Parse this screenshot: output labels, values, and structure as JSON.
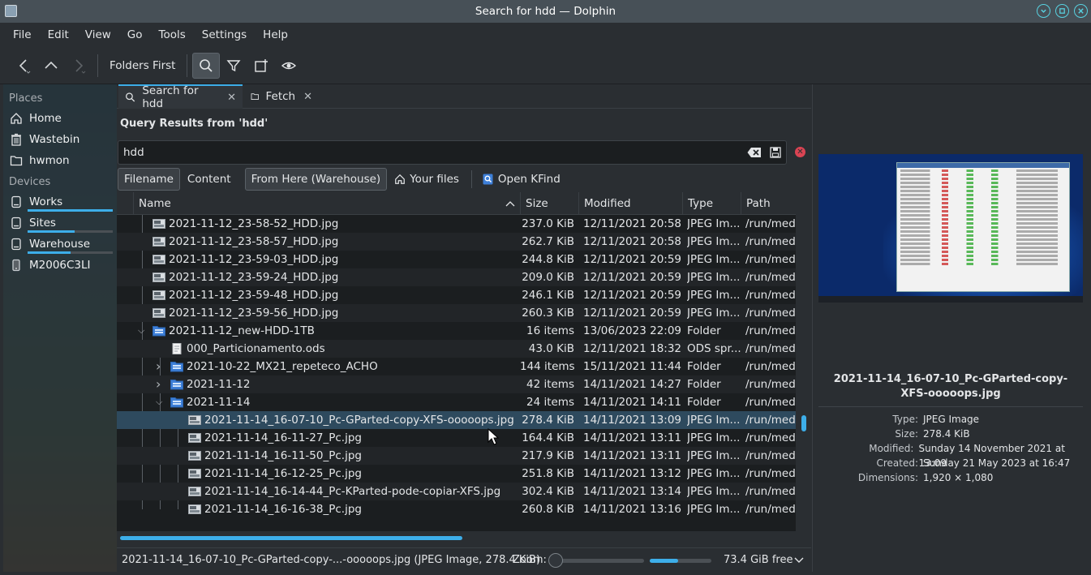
{
  "window": {
    "title": "Search for hdd — Dolphin"
  },
  "menubar": [
    "File",
    "Edit",
    "View",
    "Go",
    "Tools",
    "Settings",
    "Help"
  ],
  "toolbar": {
    "sort_label": "Folders First"
  },
  "places": {
    "places_header": "Places",
    "places_items": [
      {
        "label": "Home",
        "icon": "home-icon"
      },
      {
        "label": "Wastebin",
        "icon": "trash-icon"
      },
      {
        "label": "hwmon",
        "icon": "folder-icon"
      }
    ],
    "devices_header": "Devices",
    "devices": [
      {
        "label": "Works",
        "icon": "drive-icon",
        "usage": 1.0
      },
      {
        "label": "Sites",
        "icon": "drive-icon",
        "usage": 0.55
      },
      {
        "label": "Warehouse",
        "icon": "drive-icon",
        "usage": 0.5
      },
      {
        "label": "M2006C3LI",
        "icon": "phone-icon"
      }
    ]
  },
  "tabs": [
    {
      "label": "Search for hdd",
      "icon": "search-icon",
      "active": true
    },
    {
      "label": "Fetch",
      "icon": "folder-icon",
      "active": false
    }
  ],
  "query": {
    "title": "Query Results from 'hdd'",
    "value": "hdd"
  },
  "filters": [
    {
      "label": "Filename",
      "checked": true
    },
    {
      "label": "Content",
      "checked": false
    },
    {
      "label": "From Here (Warehouse)",
      "checked": true
    },
    {
      "label": "Your files",
      "checked": false,
      "icon": "home-icon"
    },
    {
      "label": "Open KFind",
      "checked": false,
      "icon": "kfind-icon"
    }
  ],
  "columns": {
    "name": "Name",
    "size": "Size",
    "modified": "Modified",
    "type": "Type",
    "path": "Path"
  },
  "rows": [
    {
      "name": "2021-11-12_23-58-52_HDD.jpg",
      "size": "237.0 KiB",
      "modified": "12/11/2021 20:58",
      "type": "JPEG Im...",
      "path": "/run/medi",
      "depth": 1,
      "kind": "image"
    },
    {
      "name": "2021-11-12_23-58-57_HDD.jpg",
      "size": "262.7 KiB",
      "modified": "12/11/2021 20:58",
      "type": "JPEG Im...",
      "path": "/run/medi",
      "depth": 1,
      "kind": "image"
    },
    {
      "name": "2021-11-12_23-59-03_HDD.jpg",
      "size": "244.8 KiB",
      "modified": "12/11/2021 20:59",
      "type": "JPEG Im...",
      "path": "/run/medi",
      "depth": 1,
      "kind": "image"
    },
    {
      "name": "2021-11-12_23-59-24_HDD.jpg",
      "size": "209.0 KiB",
      "modified": "12/11/2021 20:59",
      "type": "JPEG Im...",
      "path": "/run/medi",
      "depth": 1,
      "kind": "image"
    },
    {
      "name": "2021-11-12_23-59-48_HDD.jpg",
      "size": "246.1 KiB",
      "modified": "12/11/2021 20:59",
      "type": "JPEG Im...",
      "path": "/run/medi",
      "depth": 1,
      "kind": "image"
    },
    {
      "name": "2021-11-12_23-59-56_HDD.jpg",
      "size": "260.3 KiB",
      "modified": "12/11/2021 20:59",
      "type": "JPEG Im...",
      "path": "/run/medi",
      "depth": 1,
      "kind": "image"
    },
    {
      "name": "2021-11-12_new-HDD-1TB",
      "size": "16 items",
      "modified": "13/06/2023 22:09",
      "type": "Folder",
      "path": "/run/medi",
      "depth": 1,
      "kind": "folder",
      "expanded": true
    },
    {
      "name": "000_Particionamento.ods",
      "size": "43.0 KiB",
      "modified": "12/11/2021 18:32",
      "type": "ODS spr...",
      "path": "/run/medi",
      "depth": 2,
      "kind": "doc"
    },
    {
      "name": "2021-10-22_MX21_repeteco_ACHO",
      "size": "144 items",
      "modified": "15/11/2021 11:44",
      "type": "Folder",
      "path": "/run/medi",
      "depth": 2,
      "kind": "folder",
      "expanded": false
    },
    {
      "name": "2021-11-12",
      "size": "42 items",
      "modified": "14/11/2021 14:27",
      "type": "Folder",
      "path": "/run/medi",
      "depth": 2,
      "kind": "folder",
      "expanded": false
    },
    {
      "name": "2021-11-14",
      "size": "24 items",
      "modified": "14/11/2021 14:11",
      "type": "Folder",
      "path": "/run/medi",
      "depth": 2,
      "kind": "folder",
      "expanded": true
    },
    {
      "name": "2021-11-14_16-07-10_Pc-GParted-copy-XFS-ooooops.jpg",
      "size": "278.4 KiB",
      "modified": "14/11/2021 13:09",
      "type": "JPEG Im...",
      "path": "/run/medi",
      "depth": 3,
      "kind": "image",
      "selected": true
    },
    {
      "name": "2021-11-14_16-11-27_Pc.jpg",
      "size": "164.4 KiB",
      "modified": "14/11/2021 13:11",
      "type": "JPEG Im...",
      "path": "/run/medi",
      "depth": 3,
      "kind": "image"
    },
    {
      "name": "2021-11-14_16-11-50_Pc.jpg",
      "size": "217.9 KiB",
      "modified": "14/11/2021 13:11",
      "type": "JPEG Im...",
      "path": "/run/medi",
      "depth": 3,
      "kind": "image"
    },
    {
      "name": "2021-11-14_16-12-25_Pc.jpg",
      "size": "251.8 KiB",
      "modified": "14/11/2021 13:12",
      "type": "JPEG Im...",
      "path": "/run/medi",
      "depth": 3,
      "kind": "image"
    },
    {
      "name": "2021-11-14_16-14-44_Pc-KParted-pode-copiar-XFS.jpg",
      "size": "302.4 KiB",
      "modified": "14/11/2021 13:14",
      "type": "JPEG Im...",
      "path": "/run/medi",
      "depth": 3,
      "kind": "image"
    },
    {
      "name": "2021-11-14_16-16-38_Pc.jpg",
      "size": "260.8 KiB",
      "modified": "14/11/2021 13:16",
      "type": "JPEG Im...",
      "path": "/run/medi",
      "depth": 3,
      "kind": "image"
    }
  ],
  "statusbar": {
    "selection": "2021-11-14_16-07-10_Pc-GParted-copy-...-ooooops.jpg (JPEG Image, 278.4 KiB)",
    "zoom_label": "Zoom:",
    "free_space": "73.4 GiB free",
    "disk_usage": 0.46
  },
  "info": {
    "title": "2021-11-14_16-07-10_Pc-GParted-copy-XFS-ooooops.jpg",
    "meta": [
      {
        "key": "Type:",
        "value": "JPEG Image"
      },
      {
        "key": "Size:",
        "value": "278.4 KiB"
      },
      {
        "key": "Modified:",
        "value": "Sunday 14 November 2021 at 13:09"
      },
      {
        "key": "Created:",
        "value": "Sunday 21 May 2023 at 16:47"
      },
      {
        "key": "Dimensions:",
        "value": "1,920 × 1,080"
      }
    ]
  },
  "colors": {
    "accent": "#3daee9",
    "selection": "#2e4a5e",
    "close_red": "#da4453"
  }
}
